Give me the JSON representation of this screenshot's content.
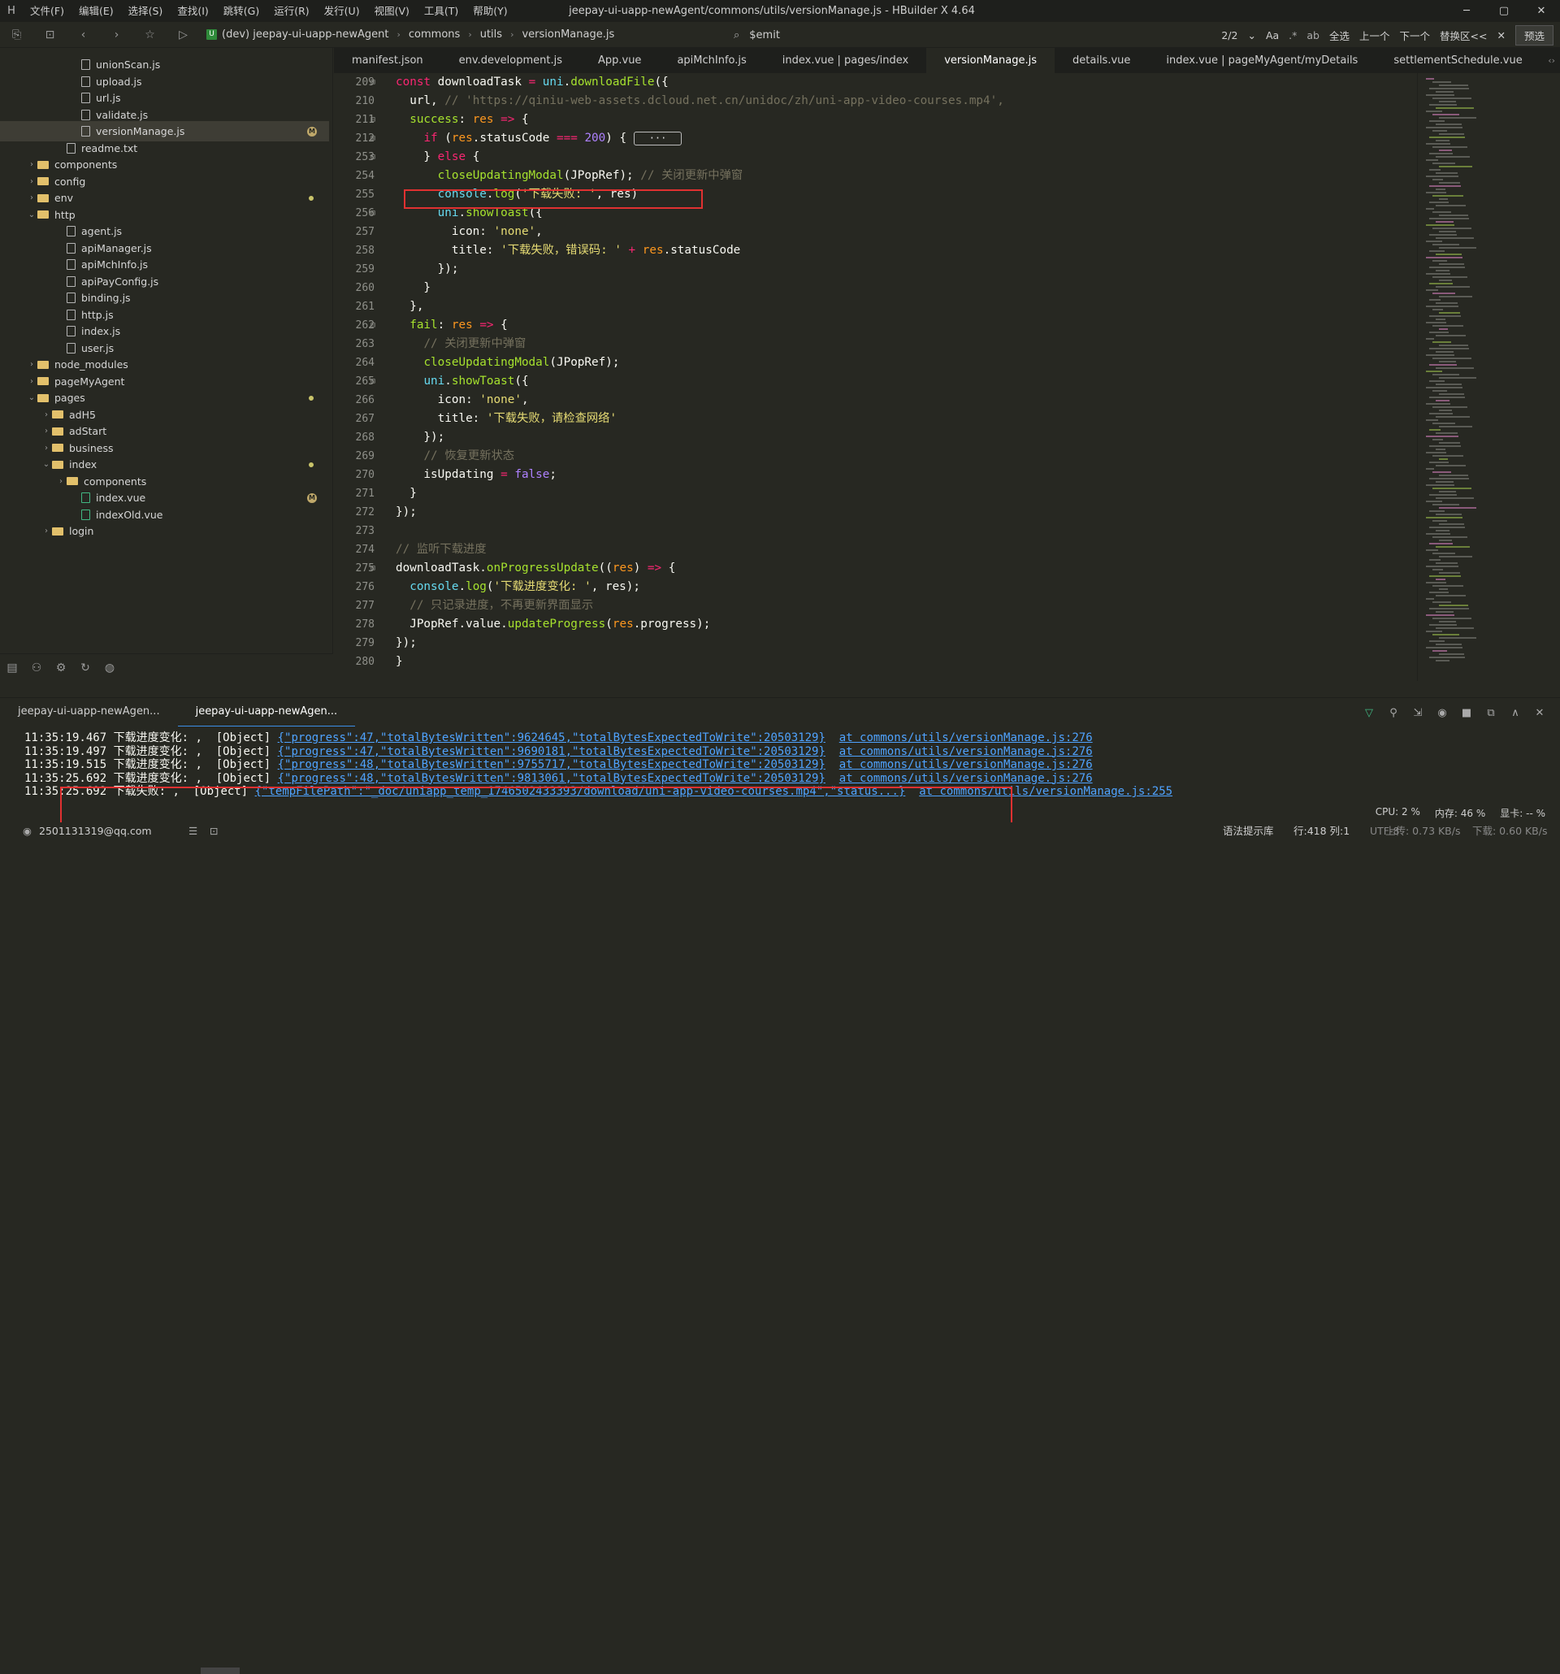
{
  "window": {
    "title": "jeepay-ui-uapp-newAgent/commons/utils/versionManage.js - HBuilder X 4.64",
    "menu": [
      "文件(F)",
      "编辑(E)",
      "选择(S)",
      "查找(I)",
      "跳转(G)",
      "运行(R)",
      "发行(U)",
      "视图(V)",
      "工具(T)",
      "帮助(Y)"
    ]
  },
  "toolbar": {
    "breadcrumb": [
      "(dev) jeepay-ui-uapp-newAgent",
      "commons",
      "utils",
      "versionManage.js"
    ],
    "find_text": "$emit",
    "match_count": "2/2",
    "find_actions": [
      "Aa",
      "全选",
      "上一个",
      "下一个",
      "替换区<<"
    ],
    "preview": "预选"
  },
  "sidebar": {
    "items": [
      {
        "label": "unionScan.js",
        "type": "file",
        "depth": 4
      },
      {
        "label": "upload.js",
        "type": "file",
        "depth": 4
      },
      {
        "label": "url.js",
        "type": "file",
        "depth": 4
      },
      {
        "label": "validate.js",
        "type": "file",
        "depth": 4
      },
      {
        "label": "versionManage.js",
        "type": "file",
        "depth": 4,
        "selected": true,
        "badge": "M"
      },
      {
        "label": "readme.txt",
        "type": "file",
        "depth": 3
      },
      {
        "label": "components",
        "type": "folder",
        "depth": 1,
        "collapsed": true
      },
      {
        "label": "config",
        "type": "folder",
        "depth": 1,
        "collapsed": true
      },
      {
        "label": "env",
        "type": "folder",
        "depth": 1,
        "collapsed": true,
        "dot": true
      },
      {
        "label": "http",
        "type": "folder",
        "depth": 1,
        "collapsed": false
      },
      {
        "label": "agent.js",
        "type": "file",
        "depth": 3
      },
      {
        "label": "apiManager.js",
        "type": "file",
        "depth": 3
      },
      {
        "label": "apiMchInfo.js",
        "type": "file",
        "depth": 3
      },
      {
        "label": "apiPayConfig.js",
        "type": "file",
        "depth": 3
      },
      {
        "label": "binding.js",
        "type": "file",
        "depth": 3
      },
      {
        "label": "http.js",
        "type": "file",
        "depth": 3
      },
      {
        "label": "index.js",
        "type": "file",
        "depth": 3
      },
      {
        "label": "user.js",
        "type": "file",
        "depth": 3
      },
      {
        "label": "node_modules",
        "type": "folder",
        "depth": 1,
        "collapsed": true
      },
      {
        "label": "pageMyAgent",
        "type": "folder",
        "depth": 1,
        "collapsed": true
      },
      {
        "label": "pages",
        "type": "folder",
        "depth": 1,
        "collapsed": false,
        "dot": true
      },
      {
        "label": "adH5",
        "type": "folder",
        "depth": 2,
        "collapsed": true
      },
      {
        "label": "adStart",
        "type": "folder",
        "depth": 2,
        "collapsed": true
      },
      {
        "label": "business",
        "type": "folder",
        "depth": 2,
        "collapsed": true
      },
      {
        "label": "index",
        "type": "folder",
        "depth": 2,
        "collapsed": false,
        "dot": true
      },
      {
        "label": "components",
        "type": "folder",
        "depth": 3,
        "collapsed": true
      },
      {
        "label": "index.vue",
        "type": "vue",
        "depth": 4,
        "badge": "M"
      },
      {
        "label": "indexOld.vue",
        "type": "vue",
        "depth": 4
      },
      {
        "label": "login",
        "type": "folder",
        "depth": 2,
        "collapsed": true
      }
    ]
  },
  "tabs": [
    "manifest.json",
    "env.development.js",
    "App.vue",
    "apiMchInfo.js",
    "index.vue | pages/index",
    "versionManage.js",
    "details.vue",
    "index.vue | pageMyAgent/myDetails",
    "settlementSchedule.vue"
  ],
  "active_tab": 5,
  "editor": {
    "lines": [
      {
        "n": "209",
        "fold": "⊟",
        "html": "<span class='kw'>const</span> <span class='fl'>downloadTask</span> <span class='kw'>=</span> <span class='fn'>uni</span>.<span class='pr'>downloadFile</span>({"
      },
      {
        "n": "210",
        "fold": "",
        "html": "  url, <span class='cm'>// 'https://qiniu-web-assets.dcloud.net.cn/unidoc/zh/uni-app-video-courses.mp4',</span>"
      },
      {
        "n": "211",
        "fold": "⊟",
        "html": "  <span class='pr'>success</span>: <span class='vb'>res</span> <span class='kw'>=&gt;</span> {"
      },
      {
        "n": "212",
        "fold": "⊞",
        "html": "    <span class='kw'>if</span> (<span class='vb'>res</span>.<span class='fl'>statusCode</span> <span class='kw'>===</span> <span class='nm'>200</span>) { <span class='ellip'>···</span>"
      },
      {
        "n": "253",
        "fold": "⊟",
        "html": "    } <span class='kw'>else</span> {"
      },
      {
        "n": "254",
        "fold": "",
        "html": "      <span class='pr'>closeUpdatingModal</span>(JPopRef); <span class='cm'>// 关闭更新中弹窗</span>"
      },
      {
        "n": "255",
        "fold": "",
        "html": "      <span class='fn'>console</span>.<span class='pr'>log</span>(<span class='st'>'下载失败: '</span>, res)"
      },
      {
        "n": "256",
        "fold": "⊟",
        "html": "      <span class='fn'>uni</span>.<span class='pr'>showToast</span>({"
      },
      {
        "n": "257",
        "fold": "",
        "html": "        icon: <span class='st'>'none'</span>,"
      },
      {
        "n": "258",
        "fold": "",
        "html": "        title: <span class='st'>'下载失败，错误码: '</span> <span class='kw'>+</span> <span class='vb'>res</span>.<span class='fl'>statusCode</span>"
      },
      {
        "n": "259",
        "fold": "",
        "html": "      });"
      },
      {
        "n": "260",
        "fold": "",
        "html": "    }"
      },
      {
        "n": "261",
        "fold": "",
        "html": "  },"
      },
      {
        "n": "262",
        "fold": "⊟",
        "html": "  <span class='pr'>fail</span>: <span class='vb'>res</span> <span class='kw'>=&gt;</span> {"
      },
      {
        "n": "263",
        "fold": "",
        "html": "    <span class='cm'>// 关闭更新中弹窗</span>"
      },
      {
        "n": "264",
        "fold": "",
        "html": "    <span class='pr'>closeUpdatingModal</span>(JPopRef);"
      },
      {
        "n": "265",
        "fold": "⊟",
        "html": "    <span class='fn'>uni</span>.<span class='pr'>showToast</span>({"
      },
      {
        "n": "266",
        "fold": "",
        "html": "      icon: <span class='st'>'none'</span>,"
      },
      {
        "n": "267",
        "fold": "",
        "html": "      title: <span class='st'>'下载失败，请检查网络'</span>"
      },
      {
        "n": "268",
        "fold": "",
        "html": "    });"
      },
      {
        "n": "269",
        "fold": "",
        "html": "    <span class='cm'>// 恢复更新状态</span>"
      },
      {
        "n": "270",
        "fold": "",
        "html": "    isUpdating <span class='kw'>=</span> <span class='nm'>false</span>;"
      },
      {
        "n": "271",
        "fold": "",
        "html": "  }"
      },
      {
        "n": "272",
        "fold": "",
        "html": "});"
      },
      {
        "n": "273",
        "fold": "",
        "html": ""
      },
      {
        "n": "274",
        "fold": "",
        "html": "<span class='cm'>// 监听下载进度</span>"
      },
      {
        "n": "275",
        "fold": "⊟",
        "html": "<span class='fl'>downloadTask</span>.<span class='pr'>onProgressUpdate</span>((<span class='vb'>res</span>) <span class='kw'>=&gt;</span> {"
      },
      {
        "n": "276",
        "fold": "",
        "html": "  <span class='fn'>console</span>.<span class='pr'>log</span>(<span class='st'>'下载进度变化: '</span>, res);"
      },
      {
        "n": "277",
        "fold": "",
        "html": "  <span class='cm'>// 只记录进度，不再更新界面显示</span>"
      },
      {
        "n": "278",
        "fold": "",
        "html": "  JPopRef.<span class='fl'>value</span>.<span class='pr'>updateProgress</span>(<span class='vb'>res</span>.<span class='fl'>progress</span>);"
      },
      {
        "n": "279",
        "fold": "",
        "html": "});"
      },
      {
        "n": "280",
        "fold": "",
        "html": "}"
      }
    ]
  },
  "panel": {
    "tabs": [
      "jeepay-ui-uapp-newAgen...",
      "jeepay-ui-uapp-newAgen..."
    ],
    "active": 1,
    "console": [
      {
        "time": "11:35:19.467",
        "msg": "下载进度变化: ,  [Object] ",
        "link": "{\"progress\":47,\"totalBytesWritten\":9624645,\"totalBytesExpectedToWrite\":20503129}",
        "src": "at commons/utils/versionManage.js:276"
      },
      {
        "time": "11:35:19.497",
        "msg": "下载进度变化: ,  [Object] ",
        "link": "{\"progress\":47,\"totalBytesWritten\":9690181,\"totalBytesExpectedToWrite\":20503129}",
        "src": "at commons/utils/versionManage.js:276"
      },
      {
        "time": "11:35:19.515",
        "msg": "下载进度变化: ,  [Object] ",
        "link": "{\"progress\":48,\"totalBytesWritten\":9755717,\"totalBytesExpectedToWrite\":20503129}",
        "src": "at commons/utils/versionManage.js:276"
      },
      {
        "time": "11:35:25.692",
        "msg": "下载进度变化: ,  [Object] ",
        "link": "{\"progress\":48,\"totalBytesWritten\":9813061,\"totalBytesExpectedToWrite\":20503129}",
        "src": "at commons/utils/versionManage.js:276"
      },
      {
        "time": "11:35:25.692",
        "msg": "下载失败: ,  [Object] ",
        "link": "{\"tempFilePath\":\"_doc/uniapp_temp_1746502433393/download/uni-app-video-courses.mp4\",\"status...}",
        "src": "at commons/utils/versionManage.js:255"
      }
    ]
  },
  "system": {
    "cpu": "CPU: 2 %",
    "mem": "内存: 46 %",
    "gpu": "显卡: -- %"
  },
  "status": {
    "user": "2501131319@qq.com",
    "hint": "语法提示库",
    "position": "行:418  列:1",
    "encoding": "UTF-8",
    "upload": "上传: 0.73 KB/s",
    "download": "下载: 0.60 KB/s"
  }
}
